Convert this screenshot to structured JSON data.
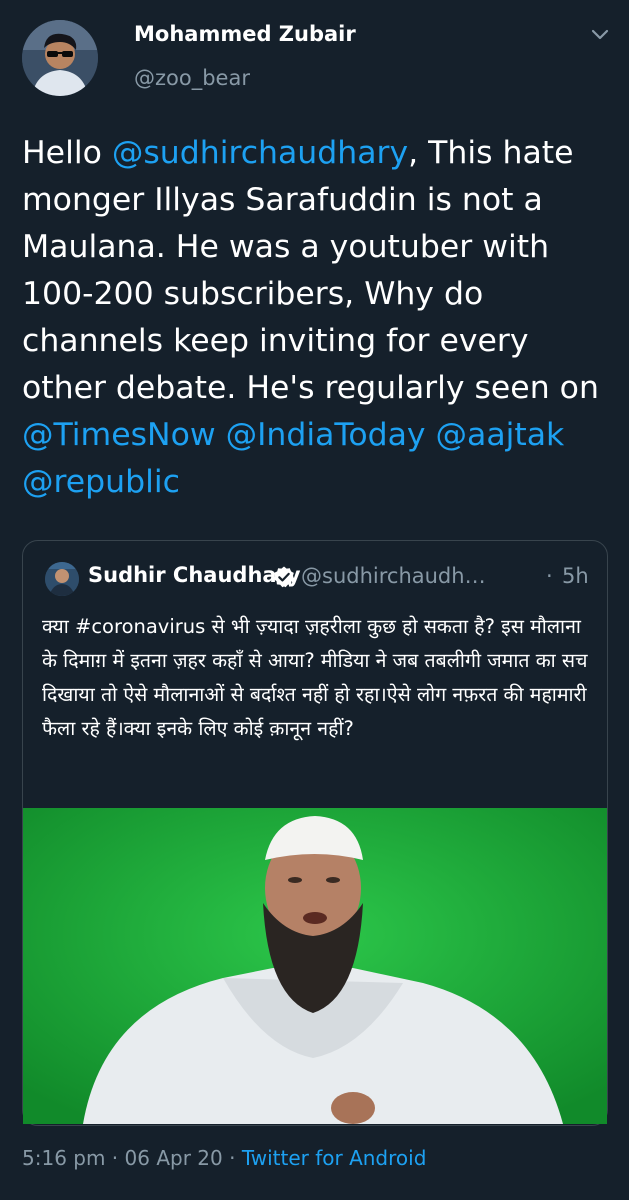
{
  "author": {
    "name": "Mohammed Zubair",
    "handle": "@zoo_bear"
  },
  "tweet": {
    "parts": [
      {
        "text": "Hello ",
        "mention": false
      },
      {
        "text": "@sudhirchaudhary",
        "mention": true
      },
      {
        "text": ", This hate monger Illyas Sarafuddin is not a Maulana. He was a youtuber with 100-200 subscribers, Why do channels keep inviting for every other debate. He's regularly seen on ",
        "mention": false
      },
      {
        "text": "@TimesNow",
        "mention": true
      },
      {
        "text": " ",
        "mention": false
      },
      {
        "text": "@IndiaToday",
        "mention": true
      },
      {
        "text": " ",
        "mention": false
      },
      {
        "text": "@aajtak",
        "mention": true
      },
      {
        "text": " ",
        "mention": false
      },
      {
        "text": "@republic",
        "mention": true
      }
    ]
  },
  "quoted_tweet": {
    "name": "Sudhir Chaudhary",
    "handle": "@sudhirchaudh…",
    "separator": "·",
    "time": "5h",
    "text": "क्या #coronavirus से भी ज़्यादा ज़हरीला कुछ हो सकता है? इस मौलाना के दिमाग़ में इतना ज़हर कहाँ से आया? मीडिया ने जब तबलीगी जमात का सच दिखाया तो ऐसे मौलानाओं से बर्दाश्त नहीं हो रहा।ऐसे लोग नफ़रत की महामारी फैला रहे हैं।क्या इनके लिए कोई क़ानून नहीं?"
  },
  "footer": {
    "time": "5:16 pm",
    "sep1": " · ",
    "date": "06 Apr 20",
    "sep2": " · ",
    "source": "Twitter for Android"
  },
  "colors": {
    "background": "#15202b",
    "link": "#1da1f2",
    "secondary_text": "#8899a6",
    "border": "#38444d",
    "media_green": "#1fa53a"
  }
}
